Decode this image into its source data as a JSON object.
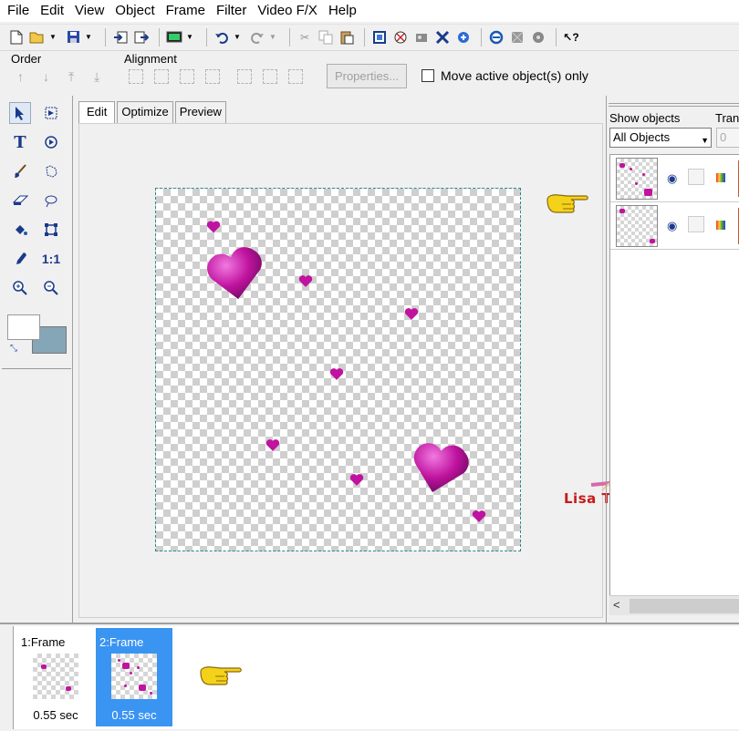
{
  "menu": [
    "File",
    "Edit",
    "View",
    "Object",
    "Frame",
    "Filter",
    "Video F/X",
    "Help"
  ],
  "toolbar": {
    "icons": [
      "new-icon",
      "open-icon",
      "save-icon",
      "import-icon",
      "export-icon",
      "preview-in-browser-icon",
      "undo-icon",
      "redo-icon",
      "cut-icon",
      "copy-icon",
      "paste-icon",
      "animation-wizard-icon",
      "banner-icon",
      "image-slicer-icon",
      "button-icon",
      "animate-icon",
      "web-icon",
      "effects-icon",
      "help-icon"
    ]
  },
  "properties_bar": {
    "order_label": "Order",
    "alignment_label": "Alignment",
    "properties_button": "Properties...",
    "move_active_label": "Move active object(s) only"
  },
  "tabs": [
    "Edit",
    "Optimize",
    "Preview"
  ],
  "objects_panel": {
    "show_objects_label": "Show objects",
    "trans_label": "Tran",
    "filter_value": "All Objects",
    "trans_value": "0"
  },
  "frames": [
    {
      "label": "1:Frame",
      "time": "0.55 sec",
      "selected": false
    },
    {
      "label": "2:Frame",
      "time": "0.55 sec",
      "selected": true
    }
  ],
  "signature": "Lisa T.",
  "colors": {
    "heart": "#c0139f",
    "selection_blue": "#3a94f2",
    "background_swatch": "#85a6b6"
  }
}
